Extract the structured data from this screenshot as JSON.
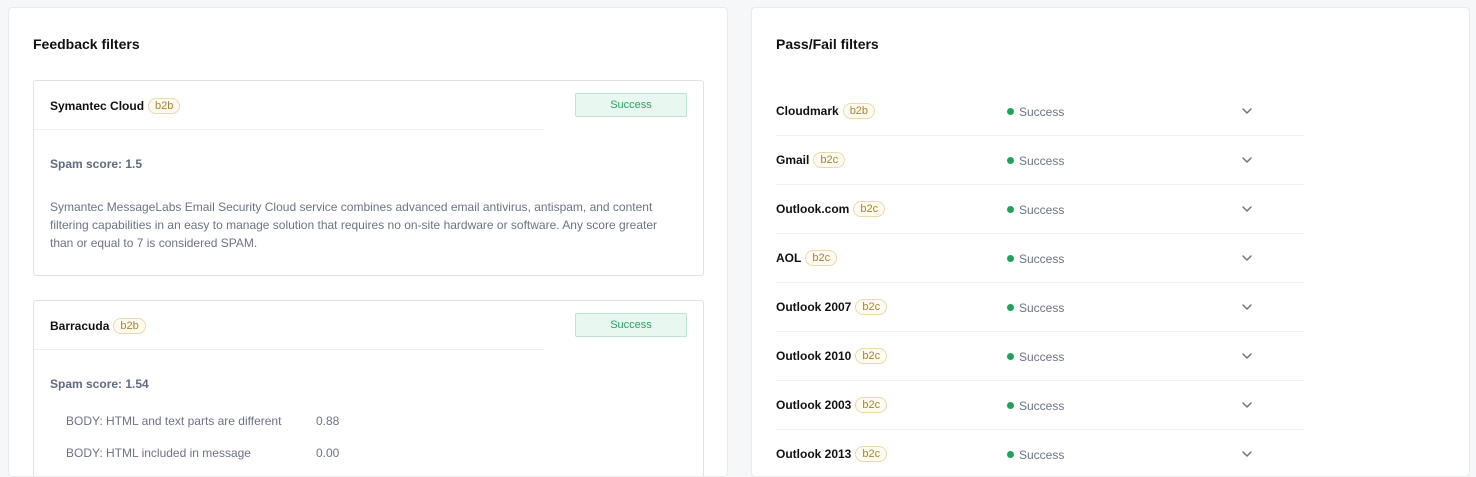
{
  "feedback": {
    "title": "Feedback filters",
    "cards": [
      {
        "name": "Symantec Cloud",
        "tag": "b2b",
        "status": "Success",
        "spam_score": "Spam score: 1.5",
        "description": "Symantec MessageLabs Email Security Cloud service combines advanced email antivirus, antispam, and content filtering capabilities in an easy to manage solution that requires no on-site hardware or software. Any score greater than or equal to 7 is considered SPAM."
      },
      {
        "name": "Barracuda",
        "tag": "b2b",
        "status": "Success",
        "spam_score": "Spam score: 1.54",
        "rules": [
          {
            "label": "BODY: HTML and text parts are different",
            "value": "0.88"
          },
          {
            "label": "BODY: HTML included in message",
            "value": "0.00"
          }
        ]
      }
    ]
  },
  "passfail": {
    "title": "Pass/Fail filters",
    "items": [
      {
        "name": "Cloudmark",
        "tag": "b2b",
        "status": "Success"
      },
      {
        "name": "Gmail",
        "tag": "b2c",
        "status": "Success"
      },
      {
        "name": "Outlook.com",
        "tag": "b2c",
        "status": "Success"
      },
      {
        "name": "AOL",
        "tag": "b2c",
        "status": "Success"
      },
      {
        "name": "Outlook 2007",
        "tag": "b2c",
        "status": "Success"
      },
      {
        "name": "Outlook 2010",
        "tag": "b2c",
        "status": "Success"
      },
      {
        "name": "Outlook 2003",
        "tag": "b2c",
        "status": "Success"
      },
      {
        "name": "Outlook 2013",
        "tag": "b2c",
        "status": "Success"
      }
    ]
  },
  "icons": {
    "expand": "chevron-down-icon",
    "status": "status-dot-icon"
  },
  "colors": {
    "success": "#23a663",
    "tag": "#a9822c"
  }
}
